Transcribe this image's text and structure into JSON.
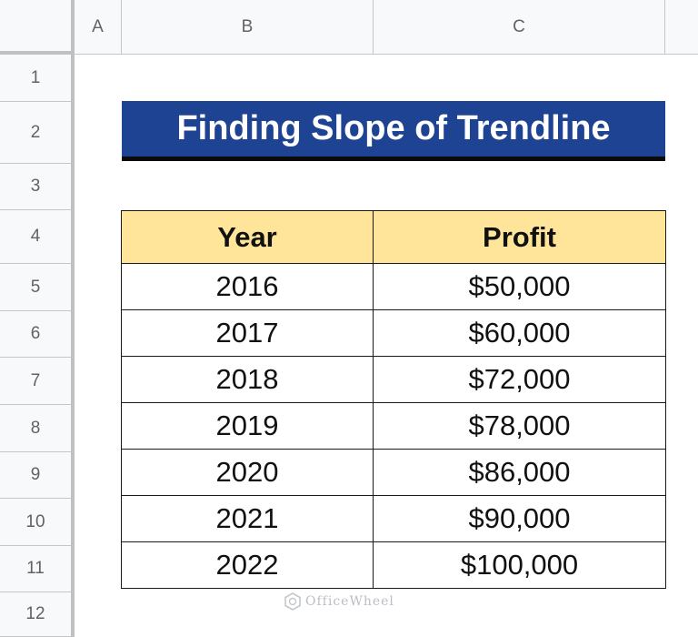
{
  "sheet": {
    "columns": [
      "A",
      "B",
      "C"
    ],
    "rows": [
      "1",
      "2",
      "3",
      "4",
      "5",
      "6",
      "7",
      "8",
      "9",
      "10",
      "11",
      "12"
    ]
  },
  "title": "Finding Slope of Trendline",
  "table": {
    "headers": [
      "Year",
      "Profit"
    ],
    "rows": [
      [
        "2016",
        "$50,000"
      ],
      [
        "2017",
        "$60,000"
      ],
      [
        "2018",
        "$72,000"
      ],
      [
        "2019",
        "$78,000"
      ],
      [
        "2020",
        "$86,000"
      ],
      [
        "2021",
        "$90,000"
      ],
      [
        "2022",
        "$100,000"
      ]
    ]
  },
  "watermark": "OfficeWheel",
  "colors": {
    "title_bg": "#1f4393",
    "header_bg": "#ffe599",
    "header_chrome": "#f8f9fa"
  }
}
